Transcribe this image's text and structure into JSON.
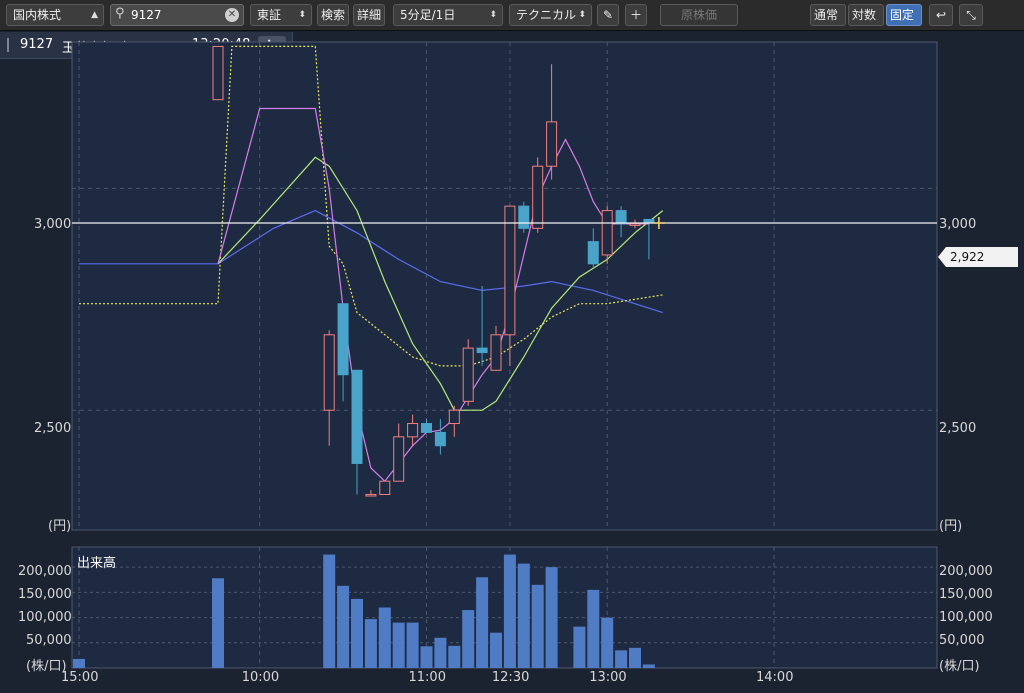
{
  "toolbar": {
    "market_select": "国内株式",
    "search_value": "9127",
    "exchange_select": "東証",
    "search_button": "検索",
    "detail_button": "詳細",
    "interval_select": "5分足/1日",
    "technical_select": "テクニカル",
    "pencil_icon": "pencil-icon",
    "plus_icon": "plus-icon",
    "original_price_button": "原株価",
    "mode_normal": "通常",
    "mode_log": "対数",
    "mode_fixed": "固定",
    "undo_icon": "undo-icon",
    "collapse_icon": "collapse-icon"
  },
  "stock": {
    "code": "9127",
    "name": "玉井商船 東２",
    "time": "13:20:48",
    "info_button": "ℹ▾"
  },
  "colors": {
    "bg": "#1b2230",
    "up_candle": "#f08080",
    "down_candle": "#4aa3c8",
    "ma_short": "#d67ee8",
    "ma_mid": "#b8e87a",
    "ma_long": "#5c6cf0",
    "ma_dotted": "#e8e85a",
    "volume": "#4f7cc4",
    "current_line": "#f2f2f2"
  },
  "chart_data": {
    "type": "candlestick",
    "price_axis": {
      "ticks": [
        3000,
        2500
      ],
      "tick_labels": [
        "3,000",
        "2,500"
      ],
      "unit_label": "(円)",
      "ylim": [
        2230,
        3330
      ],
      "current_price": 2922,
      "current_price_label": "2,922"
    },
    "volume_axis": {
      "title": "出来高",
      "ticks": [
        200000,
        150000,
        100000,
        50000
      ],
      "tick_labels": [
        "200,000",
        "150,000",
        "100,000",
        "50,000"
      ],
      "unit_label": "(株/口)",
      "ylim": [
        0,
        240000
      ]
    },
    "time_labels": [
      {
        "t": 0,
        "label": "15:00"
      },
      {
        "t": 13,
        "label": "10:00"
      },
      {
        "t": 25,
        "label": "11:00"
      },
      {
        "t": 31,
        "label": "12:30"
      },
      {
        "t": 38,
        "label": "13:00"
      },
      {
        "t": 50,
        "label": "14:00"
      }
    ],
    "candles": [
      {
        "t": 10,
        "o": 3200,
        "h": 3320,
        "l": 3200,
        "c": 3320
      },
      {
        "t": 18,
        "o": 2500,
        "h": 2680,
        "l": 2420,
        "c": 2670
      },
      {
        "t": 19,
        "o": 2740,
        "h": 2740,
        "l": 2520,
        "c": 2580
      },
      {
        "t": 20,
        "o": 2590,
        "h": 2590,
        "l": 2310,
        "c": 2380
      },
      {
        "t": 21,
        "o": 2310,
        "h": 2320,
        "l": 2310,
        "c": 2310
      },
      {
        "t": 22,
        "o": 2310,
        "h": 2340,
        "l": 2310,
        "c": 2340
      },
      {
        "t": 23,
        "o": 2340,
        "h": 2470,
        "l": 2340,
        "c": 2440
      },
      {
        "t": 24,
        "o": 2440,
        "h": 2490,
        "l": 2420,
        "c": 2470
      },
      {
        "t": 25,
        "o": 2470,
        "h": 2480,
        "l": 2450,
        "c": 2450
      },
      {
        "t": 26,
        "o": 2450,
        "h": 2480,
        "l": 2400,
        "c": 2420
      },
      {
        "t": 27,
        "o": 2470,
        "h": 2510,
        "l": 2440,
        "c": 2500
      },
      {
        "t": 28,
        "o": 2520,
        "h": 2660,
        "l": 2510,
        "c": 2640
      },
      {
        "t": 29,
        "o": 2640,
        "h": 2780,
        "l": 2600,
        "c": 2630
      },
      {
        "t": 30,
        "o": 2590,
        "h": 2690,
        "l": 2590,
        "c": 2670
      },
      {
        "t": 31,
        "o": 2670,
        "h": 2940,
        "l": 2600,
        "c": 2960
      },
      {
        "t": 32,
        "o": 2960,
        "h": 2970,
        "l": 2900,
        "c": 2910
      },
      {
        "t": 33,
        "o": 2910,
        "h": 3070,
        "l": 2900,
        "c": 3050
      },
      {
        "t": 34,
        "o": 3050,
        "h": 3280,
        "l": 3020,
        "c": 3150
      },
      {
        "t": 37,
        "o": 2880,
        "h": 2910,
        "l": 2820,
        "c": 2830
      },
      {
        "t": 38,
        "o": 2850,
        "h": 2960,
        "l": 2830,
        "c": 2950
      },
      {
        "t": 39,
        "o": 2950,
        "h": 2960,
        "l": 2890,
        "c": 2920
      },
      {
        "t": 40,
        "o": 2920,
        "h": 2930,
        "l": 2910,
        "c": 2920
      },
      {
        "t": 41,
        "o": 2930,
        "h": 2930,
        "l": 2840,
        "c": 2922
      }
    ],
    "ma_short": [
      {
        "t": 10,
        "v": 2830
      },
      {
        "t": 13,
        "v": 3180
      },
      {
        "t": 17,
        "v": 3180
      },
      {
        "t": 18,
        "v": 3000
      },
      {
        "t": 19,
        "v": 2730
      },
      {
        "t": 20,
        "v": 2500
      },
      {
        "t": 21,
        "v": 2370
      },
      {
        "t": 22,
        "v": 2340
      },
      {
        "t": 23,
        "v": 2380
      },
      {
        "t": 24,
        "v": 2420
      },
      {
        "t": 25,
        "v": 2450
      },
      {
        "t": 26,
        "v": 2455
      },
      {
        "t": 27,
        "v": 2480
      },
      {
        "t": 28,
        "v": 2530
      },
      {
        "t": 29,
        "v": 2580
      },
      {
        "t": 30,
        "v": 2620
      },
      {
        "t": 31,
        "v": 2720
      },
      {
        "t": 32,
        "v": 2850
      },
      {
        "t": 33,
        "v": 2980
      },
      {
        "t": 34,
        "v": 3050
      },
      {
        "t": 35,
        "v": 3110
      },
      {
        "t": 36,
        "v": 3050
      },
      {
        "t": 37,
        "v": 2970
      },
      {
        "t": 38,
        "v": 2920
      },
      {
        "t": 39,
        "v": 2920
      },
      {
        "t": 40,
        "v": 2920
      },
      {
        "t": 41,
        "v": 2920
      }
    ],
    "ma_mid": [
      {
        "t": 10,
        "v": 2830
      },
      {
        "t": 13,
        "v": 2930
      },
      {
        "t": 17,
        "v": 3070
      },
      {
        "t": 18,
        "v": 3050
      },
      {
        "t": 20,
        "v": 2950
      },
      {
        "t": 22,
        "v": 2790
      },
      {
        "t": 24,
        "v": 2650
      },
      {
        "t": 26,
        "v": 2560
      },
      {
        "t": 27,
        "v": 2500
      },
      {
        "t": 28,
        "v": 2500
      },
      {
        "t": 29,
        "v": 2500
      },
      {
        "t": 30,
        "v": 2520
      },
      {
        "t": 32,
        "v": 2620
      },
      {
        "t": 34,
        "v": 2730
      },
      {
        "t": 36,
        "v": 2800
      },
      {
        "t": 38,
        "v": 2840
      },
      {
        "t": 40,
        "v": 2900
      },
      {
        "t": 42,
        "v": 2950
      }
    ],
    "ma_long": [
      {
        "t": 0,
        "v": 2830
      },
      {
        "t": 10,
        "v": 2830
      },
      {
        "t": 14,
        "v": 2910
      },
      {
        "t": 17,
        "v": 2950
      },
      {
        "t": 20,
        "v": 2900
      },
      {
        "t": 23,
        "v": 2840
      },
      {
        "t": 26,
        "v": 2790
      },
      {
        "t": 29,
        "v": 2770
      },
      {
        "t": 32,
        "v": 2780
      },
      {
        "t": 34,
        "v": 2790
      },
      {
        "t": 37,
        "v": 2770
      },
      {
        "t": 42,
        "v": 2720
      }
    ],
    "ma_dotted": [
      {
        "t": 0,
        "v": 2740
      },
      {
        "t": 10,
        "v": 2740
      },
      {
        "t": 11,
        "v": 3320
      },
      {
        "t": 17,
        "v": 3320
      },
      {
        "t": 18,
        "v": 2870
      },
      {
        "t": 19,
        "v": 2830
      },
      {
        "t": 20,
        "v": 2720
      },
      {
        "t": 22,
        "v": 2670
      },
      {
        "t": 24,
        "v": 2620
      },
      {
        "t": 26,
        "v": 2600
      },
      {
        "t": 28,
        "v": 2600
      },
      {
        "t": 30,
        "v": 2620
      },
      {
        "t": 32,
        "v": 2660
      },
      {
        "t": 34,
        "v": 2710
      },
      {
        "t": 36,
        "v": 2740
      },
      {
        "t": 38,
        "v": 2740
      },
      {
        "t": 40,
        "v": 2750
      },
      {
        "t": 42,
        "v": 2760
      }
    ],
    "volume": [
      {
        "t": 0,
        "v": 18000
      },
      {
        "t": 10,
        "v": 178000
      },
      {
        "t": 18,
        "v": 225000
      },
      {
        "t": 19,
        "v": 163000
      },
      {
        "t": 20,
        "v": 137000
      },
      {
        "t": 21,
        "v": 97000
      },
      {
        "t": 22,
        "v": 120000
      },
      {
        "t": 23,
        "v": 90000
      },
      {
        "t": 24,
        "v": 90000
      },
      {
        "t": 25,
        "v": 43000
      },
      {
        "t": 26,
        "v": 60000
      },
      {
        "t": 27,
        "v": 44000
      },
      {
        "t": 28,
        "v": 115000
      },
      {
        "t": 29,
        "v": 180000
      },
      {
        "t": 30,
        "v": 70000
      },
      {
        "t": 31,
        "v": 225000
      },
      {
        "t": 32,
        "v": 207000
      },
      {
        "t": 33,
        "v": 165000
      },
      {
        "t": 34,
        "v": 200000
      },
      {
        "t": 36,
        "v": 82000
      },
      {
        "t": 37,
        "v": 155000
      },
      {
        "t": 38,
        "v": 100000
      },
      {
        "t": 39,
        "v": 35000
      },
      {
        "t": 40,
        "v": 40000
      },
      {
        "t": 41,
        "v": 7000
      }
    ]
  }
}
